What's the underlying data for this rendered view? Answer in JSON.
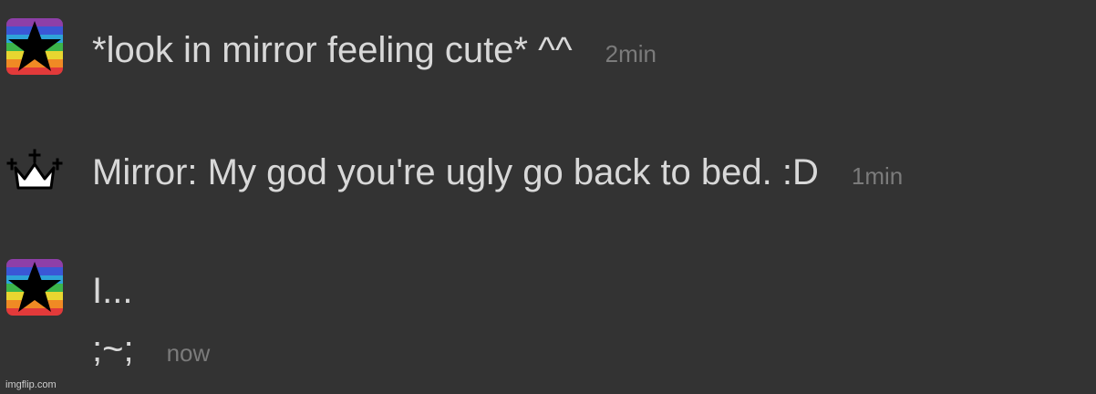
{
  "messages": [
    {
      "avatar": "rainbow-star-avatar",
      "lines": [
        "*look in mirror feeling cute* ^^"
      ],
      "time": "2min"
    },
    {
      "avatar": "crown-avatar",
      "lines": [
        "Mirror: My god you're ugly go back to bed. :D"
      ],
      "time": "1min"
    },
    {
      "avatar": "rainbow-star-avatar",
      "lines": [
        "I...",
        ";~;"
      ],
      "time": "now"
    }
  ],
  "watermark": "imgflip.com",
  "colors": {
    "background": "#333333",
    "text": "#d8d8d8",
    "timestamp": "#7b7b7b",
    "rainbow": [
      "#8e3fa8",
      "#3a57d6",
      "#2ea3d8",
      "#3cb54a",
      "#e8d630",
      "#f08a24",
      "#e23a3a"
    ]
  }
}
